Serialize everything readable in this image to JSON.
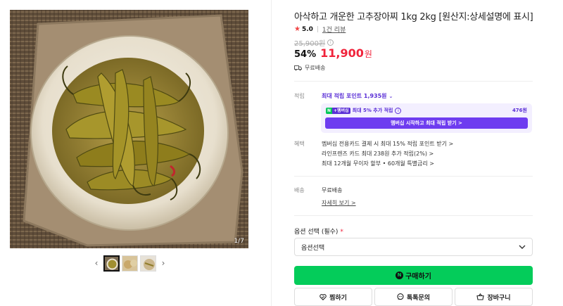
{
  "gallery": {
    "counter": "1/7",
    "prev_arrow": "‹",
    "next_arrow": "›"
  },
  "product": {
    "title": "아삭하고 개운한 고추장아찌 1kg 2kg [원산지:상세설명에 표시]",
    "rating": "5.0",
    "review_count": "1건 리뷰",
    "original_price": "25,900원",
    "discount": "54%",
    "sale_price": "11,900",
    "sale_unit": "원",
    "shipping_short": "무료배송"
  },
  "points": {
    "label": "적립",
    "max_points": "최대 적립 포인트 1,935원",
    "membership_badge_n": "N",
    "membership_badge_plus": "+멤버십",
    "membership_text": "최대 5% 추가 적립",
    "membership_amount": "476원",
    "membership_button": "멤버십 시작하고 최대 적립 받기 >"
  },
  "benefits": {
    "label": "혜택",
    "items": [
      "멤버십 전용카드 결제 시 최대 15% 적립 포인트 받기 >",
      "라인프렌즈 카드 최대 238원 추가 적립(2%) >",
      "최대 12개월 무이자 할부 • 60개월 특별금리 >"
    ]
  },
  "delivery": {
    "label": "배송",
    "value": "무료배송",
    "detail_link": "자세히 보기 >"
  },
  "options": {
    "label": "옵션 선택 (필수)",
    "required_mark": "*",
    "select_value": "옵션선택"
  },
  "actions": {
    "buy": "구매하기",
    "buy_badge": "N",
    "wish": "찜하기",
    "talk": "톡톡문의",
    "cart": "장바구니"
  },
  "colors": {
    "sale_red": "#f0233b",
    "naver_green": "#04cc5a",
    "membership_purple": "#6e3cf0"
  },
  "icons": [
    "star-icon",
    "info-icon",
    "truck-icon",
    "chevron-down-icon",
    "heart-icon",
    "chat-icon",
    "cart-icon",
    "chevron-left-icon",
    "chevron-right-icon"
  ]
}
